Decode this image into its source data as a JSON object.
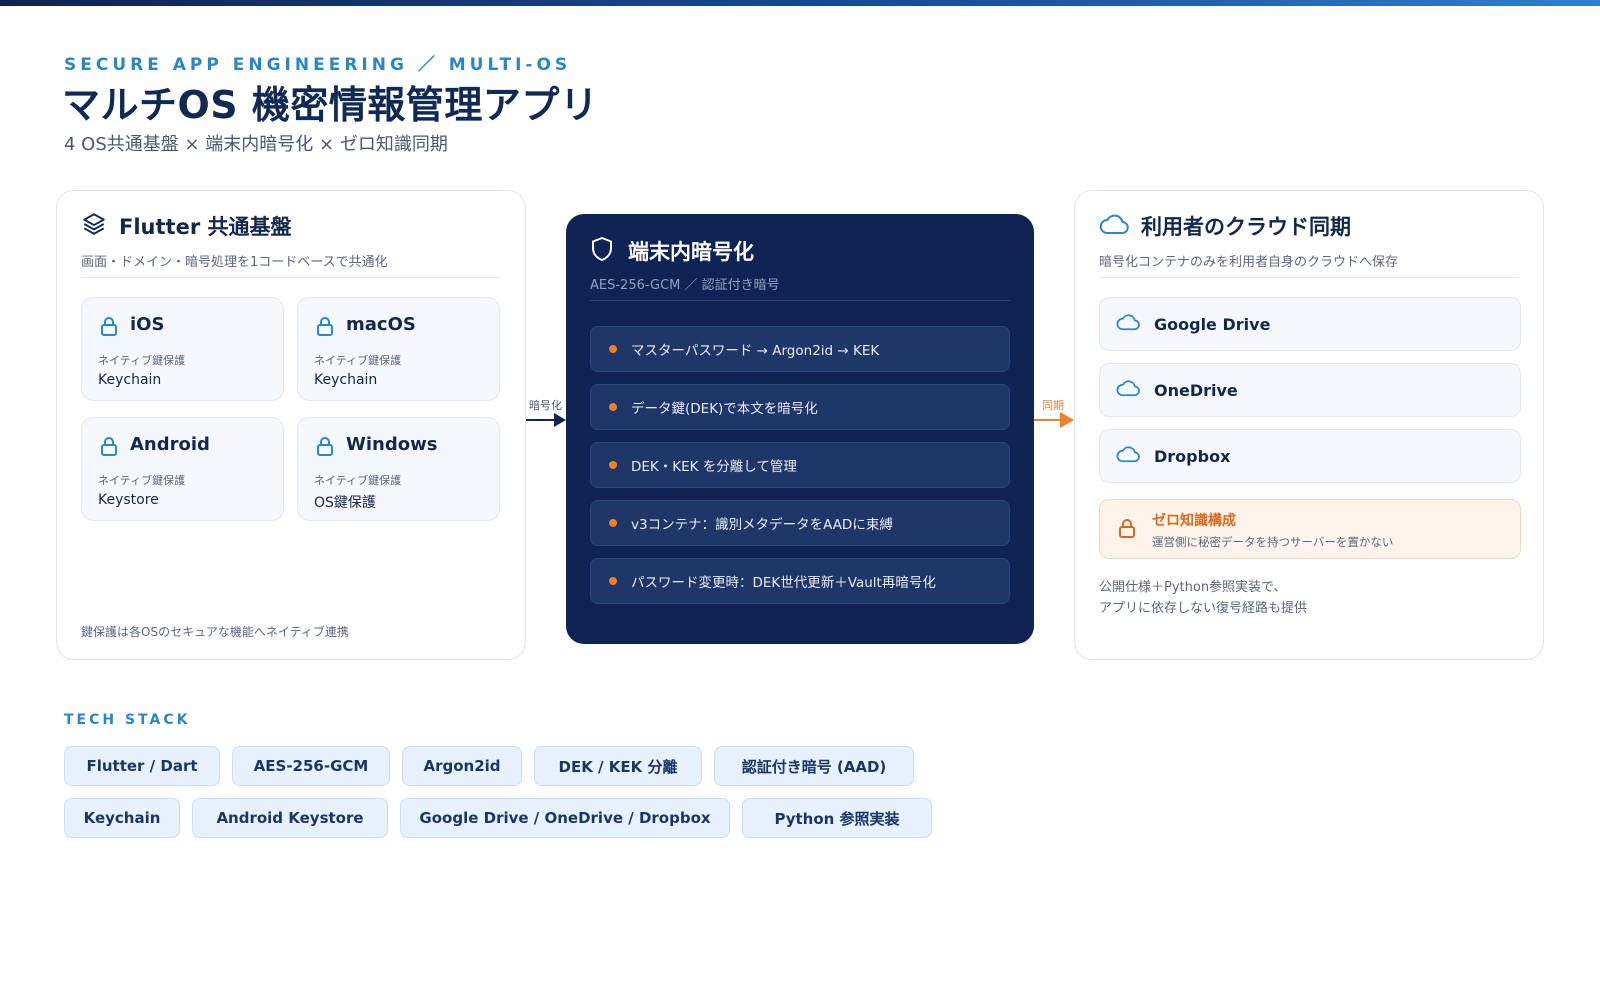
{
  "header": {
    "eyebrow": "SECURE APP ENGINEERING ／ MULTI-OS",
    "title": "マルチOS 機密情報管理アプリ",
    "subtitle": "4 OS共通基盤 × 端末内暗号化 × ゼロ知識同期"
  },
  "left": {
    "title": "Flutter 共通基盤",
    "desc": "画面・ドメイン・暗号処理を1コードベースで共通化",
    "tiles": [
      {
        "name": "iOS",
        "label": "ネイティブ鍵保護",
        "value": "Keychain"
      },
      {
        "name": "macOS",
        "label": "ネイティブ鍵保護",
        "value": "Keychain"
      },
      {
        "name": "Android",
        "label": "ネイティブ鍵保護",
        "value": "Keystore"
      },
      {
        "name": "Windows",
        "label": "ネイティブ鍵保護",
        "value": "OS鍵保護"
      }
    ],
    "footer": "鍵保護は各OSのセキュアな機能へネイティブ連携"
  },
  "arrows": {
    "encrypt": "暗号化",
    "sync": "同期"
  },
  "middle": {
    "title": "端末内暗号化",
    "desc": "AES-256-GCM ／ 認証付き暗号",
    "steps": [
      "マスターパスワード → Argon2id → KEK",
      "データ鍵(DEK)で本文を暗号化",
      "DEK・KEK を分離して管理",
      "v3コンテナ：識別メタデータをAADに束縛",
      "パスワード変更時：DEK世代更新＋Vault再暗号化"
    ]
  },
  "right": {
    "title": "利用者のクラウド同期",
    "desc": "暗号化コンテナのみを利用者自身のクラウドへ保存",
    "clouds": [
      "Google Drive",
      "OneDrive",
      "Dropbox"
    ],
    "zero_knowledge": {
      "title": "ゼロ知識構成",
      "sub": "運営側に秘密データを持つサーバーを置かない"
    },
    "note_line1": "公開仕様＋Python参照実装で、",
    "note_line2": "アプリに依存しない復号経路も提供"
  },
  "tech_stack": {
    "label": "TECH STACK",
    "row1": [
      "Flutter / Dart",
      "AES-256-GCM",
      "Argon2id",
      "DEK / KEK 分離",
      "認証付き暗号 (AAD)"
    ],
    "row2": [
      "Keychain",
      "Android Keystore",
      "Google Drive / OneDrive / Dropbox",
      "Python 参照実装"
    ]
  },
  "colors": {
    "navy": "#0f2454",
    "accent_blue": "#2b86c5",
    "accent_orange": "#f07f2c"
  }
}
